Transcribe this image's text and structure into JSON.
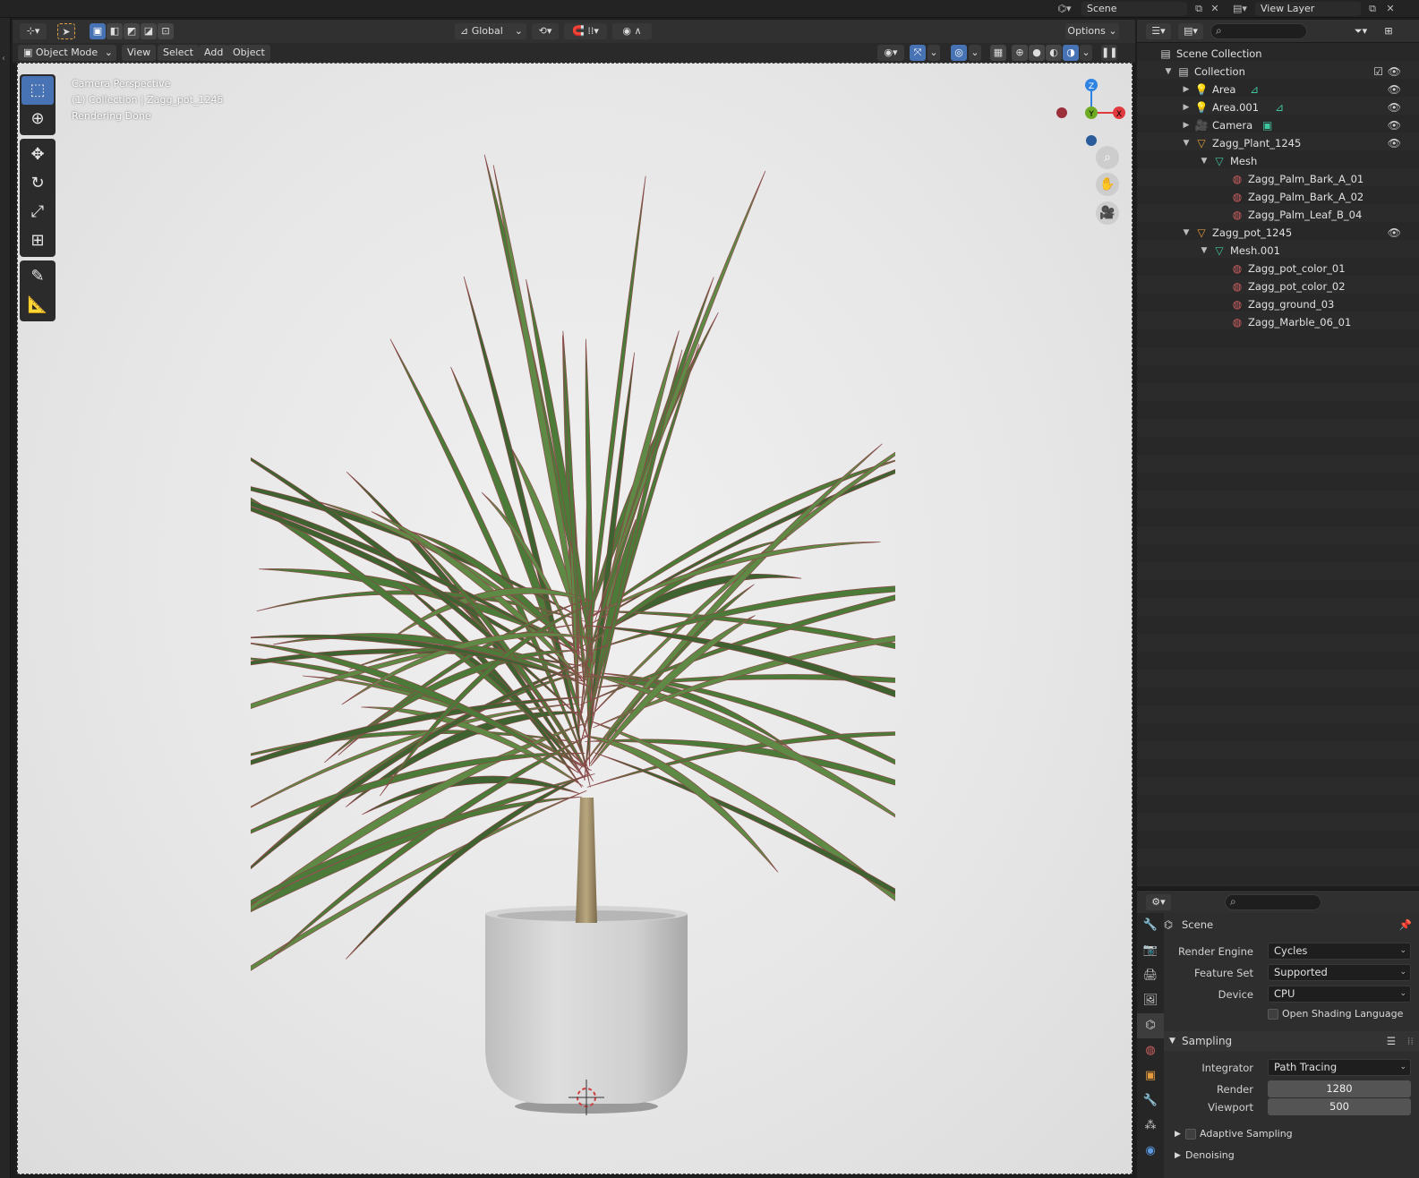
{
  "topbar": {
    "scene_name": "Scene",
    "view_layer_name": "View Layer"
  },
  "viewport_header": {
    "transform_orientation": "Global",
    "options_label": "Options",
    "mode": "Object Mode",
    "menus": [
      "View",
      "Select",
      "Add",
      "Object"
    ]
  },
  "viewport": {
    "info_lines": [
      "Camera Perspective",
      "(1) Collection | Zagg_pot_1245",
      "Rendering Done"
    ],
    "gizmo_axes": {
      "z": "Z",
      "y": "Y",
      "x": "X"
    }
  },
  "outliner": {
    "search_placeholder": "",
    "items": [
      {
        "label": "Scene Collection",
        "icon": "scene-collection-icon",
        "depth": 0,
        "expand": ""
      },
      {
        "label": "Collection",
        "icon": "collection-icon",
        "depth": 1,
        "expand": "▼"
      },
      {
        "label": "Area",
        "icon": "light-icon",
        "depth": 2,
        "expand": "▶"
      },
      {
        "label": "Area.001",
        "icon": "light-icon",
        "depth": 2,
        "expand": "▶"
      },
      {
        "label": "Camera",
        "icon": "camera-icon",
        "depth": 2,
        "expand": "▶"
      },
      {
        "label": "Zagg_Plant_1245",
        "icon": "mesh-object-icon",
        "depth": 2,
        "expand": "▼"
      },
      {
        "label": "Mesh",
        "icon": "mesh-data-icon",
        "depth": 3,
        "expand": "▼"
      },
      {
        "label": "Zagg_Palm_Bark_A_01",
        "icon": "material-icon",
        "depth": 4,
        "expand": ""
      },
      {
        "label": "Zagg_Palm_Bark_A_02",
        "icon": "material-icon",
        "depth": 4,
        "expand": ""
      },
      {
        "label": "Zagg_Palm_Leaf_B_04",
        "icon": "material-icon",
        "depth": 4,
        "expand": ""
      },
      {
        "label": "Zagg_pot_1245",
        "icon": "mesh-object-icon",
        "depth": 2,
        "expand": "▼"
      },
      {
        "label": "Mesh.001",
        "icon": "mesh-data-icon",
        "depth": 3,
        "expand": "▼"
      },
      {
        "label": "Zagg_pot_color_01",
        "icon": "material-icon",
        "depth": 4,
        "expand": ""
      },
      {
        "label": "Zagg_pot_color_02",
        "icon": "material-icon",
        "depth": 4,
        "expand": ""
      },
      {
        "label": "Zagg_ground_03",
        "icon": "material-icon",
        "depth": 4,
        "expand": ""
      },
      {
        "label": "Zagg_Marble_06_01",
        "icon": "material-icon",
        "depth": 4,
        "expand": ""
      }
    ]
  },
  "properties": {
    "context_title": "Scene",
    "render_engine_label": "Render Engine",
    "render_engine": "Cycles",
    "feature_set_label": "Feature Set",
    "feature_set": "Supported",
    "device_label": "Device",
    "device": "CPU",
    "osl_label": "Open Shading Language",
    "sampling_label": "Sampling",
    "integrator_label": "Integrator",
    "integrator": "Path Tracing",
    "render_samples_label": "Render",
    "render_samples": "1280",
    "viewport_samples_label": "Viewport",
    "viewport_samples": "500",
    "adaptive_sampling_label": "Adaptive Sampling",
    "denoising_label": "Denoising"
  },
  "colors": {
    "accent": "#4772b3",
    "axis_x": "#e0393e",
    "axis_y": "#6eaa24",
    "axis_z": "#2f83e3",
    "material": "#d06060",
    "object_orange": "#e39a3c"
  }
}
